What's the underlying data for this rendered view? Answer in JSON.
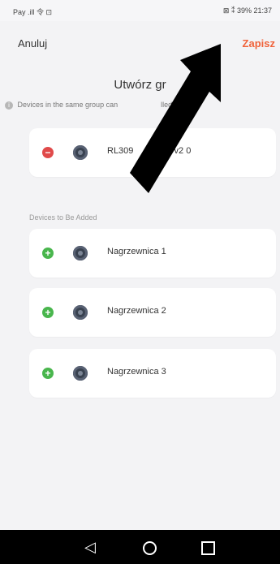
{
  "status_bar": {
    "left": "Pay .ill 令 ⊡",
    "right": "⊠ ⁑ 39% 21:37"
  },
  "header": {
    "cancel_label": "Anuluj",
    "save_label": "Zapisz",
    "title": "Utwórz gr",
    "note": "Devices in the same group can",
    "note_tail": "lled togethe"
  },
  "group": {
    "devices": [
      {
        "name": "RL309",
        "name_tail": "v2 0"
      }
    ]
  },
  "to_add": {
    "label": "Devices to Be Added",
    "devices": [
      {
        "name": "Nagrzewnica 1"
      },
      {
        "name": "Nagrzewnica 2"
      },
      {
        "name": "Nagrzewnica 3"
      }
    ]
  },
  "nav": {
    "back_icon": "back-triangle",
    "home_icon": "home-circle",
    "recents_icon": "recents-square"
  },
  "colors": {
    "accent": "#f0633b",
    "remove": "#e04a4a",
    "add": "#49b64d",
    "background": "#f3f3f5"
  }
}
